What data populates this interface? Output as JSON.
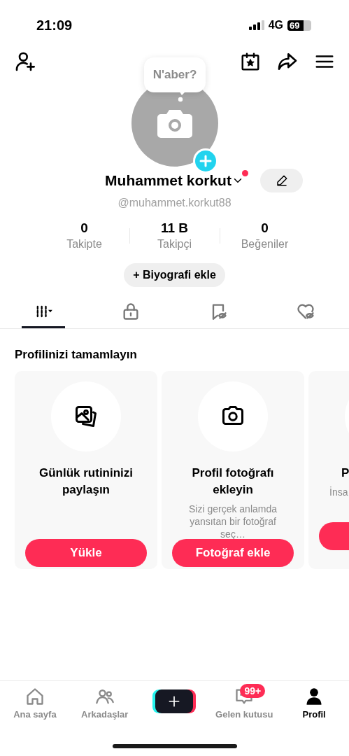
{
  "status_bar": {
    "time": "21:09",
    "network": "4G",
    "battery": "69"
  },
  "bubble": {
    "text": "N'aber?"
  },
  "profile": {
    "name": "Muhammet korkut",
    "notification_dot": true,
    "handle": "@muhammet.korkut88"
  },
  "stats": [
    {
      "value": "0",
      "label": "Takipte"
    },
    {
      "value": "11 B",
      "label": "Takipçi"
    },
    {
      "value": "0",
      "label": "Beğeniler"
    }
  ],
  "bio_button": {
    "label": "+ Biyografi ekle"
  },
  "tabs": [
    {
      "selected": true
    },
    {
      "selected": false
    },
    {
      "selected": false
    },
    {
      "selected": false
    }
  ],
  "section_title": "Profilinizi tamamlayın",
  "cards": [
    {
      "title": "Günlük rutininizi paylaşın",
      "button": "Yükle"
    },
    {
      "title": "Profil fotoğrafı ekleyin",
      "description": "Sizi gerçek anlamda yansıtan bir fotoğraf seç…",
      "button": "Fotoğraf ekle"
    },
    {
      "title": "P",
      "description": "İnsa"
    }
  ],
  "nav": [
    {
      "kind": "tab",
      "label": "Ana sayfa",
      "selected": false
    },
    {
      "kind": "tab",
      "label": "Arkadaşlar",
      "selected": false
    },
    {
      "kind": "create"
    },
    {
      "kind": "tab",
      "label": "Gelen kutusu",
      "selected": false,
      "badge": "99+"
    },
    {
      "kind": "tab",
      "label": "Profil",
      "selected": true
    }
  ]
}
